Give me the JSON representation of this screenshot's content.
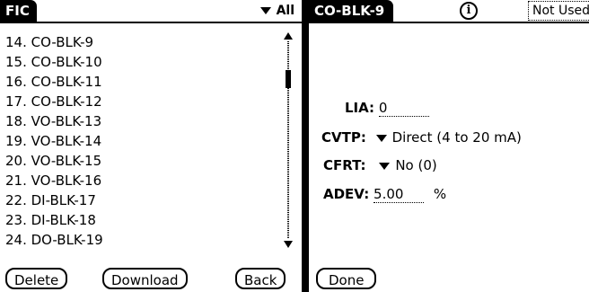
{
  "left_screen": {
    "title": "FIC",
    "category_dropdown": {
      "value": "All"
    },
    "items": [
      "14. CO-BLK-9",
      "15. CO-BLK-10",
      "16. CO-BLK-11",
      "17. CO-BLK-12",
      "18. VO-BLK-13",
      "19. VO-BLK-14",
      "20. VO-BLK-15",
      "21. VO-BLK-16",
      "22. DI-BLK-17",
      "23. DI-BLK-18",
      "24. DO-BLK-19"
    ],
    "buttons": {
      "delete": "Delete",
      "download": "Download",
      "back": "Back"
    }
  },
  "right_screen": {
    "title": "CO-BLK-9",
    "info_icon_glyph": "i",
    "status": "Not Used",
    "fields": {
      "lia": {
        "label": "LIA:",
        "value": "0"
      },
      "cvtp": {
        "label": "CVTP:",
        "value": "Direct (4 to 20 mA)"
      },
      "cfrt": {
        "label": "CFRT:",
        "value": "No (0)"
      },
      "adev": {
        "label": "ADEV:",
        "value": "5.00",
        "unit": "%"
      }
    },
    "buttons": {
      "done": "Done"
    }
  }
}
